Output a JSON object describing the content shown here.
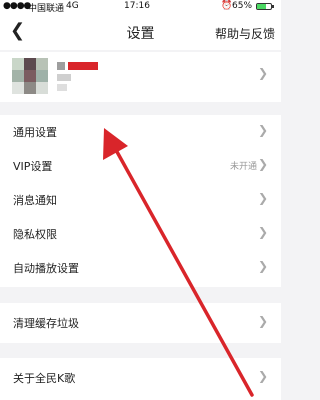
{
  "status": {
    "carrier": "中国联通",
    "network": "4G",
    "time": "17:16",
    "battery": "65%",
    "battery_level": 0.65
  },
  "nav": {
    "title": "设置",
    "help": "帮助与反馈"
  },
  "menu": [
    {
      "label": "通用设置"
    },
    {
      "label": "VIP设置",
      "value": "未开通"
    },
    {
      "label": "消息通知"
    },
    {
      "label": "隐私权限"
    },
    {
      "label": "自动播放设置"
    },
    {
      "label": "清理缓存垃圾"
    },
    {
      "label": "关于全民K歌"
    }
  ],
  "colors": {
    "accent_red": "#d9252a"
  }
}
